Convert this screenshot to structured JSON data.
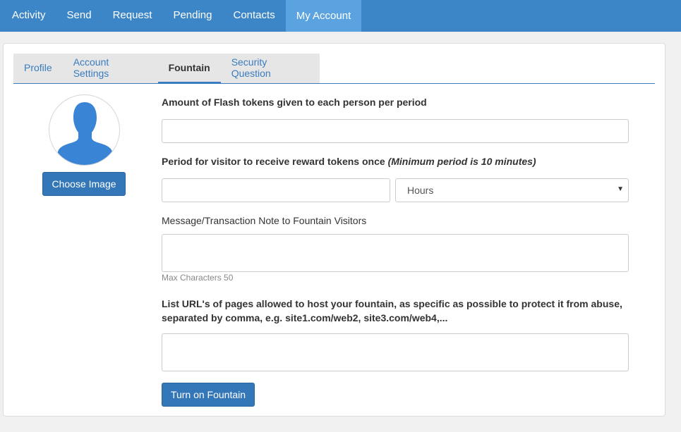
{
  "nav": {
    "items": [
      {
        "label": "Activity"
      },
      {
        "label": "Send"
      },
      {
        "label": "Request"
      },
      {
        "label": "Pending"
      },
      {
        "label": "Contacts"
      },
      {
        "label": "My Account"
      }
    ],
    "active": "My Account"
  },
  "tabs": {
    "items": [
      {
        "label": "Profile"
      },
      {
        "label": "Account Settings"
      },
      {
        "label": "Fountain"
      },
      {
        "label": "Security Question"
      }
    ],
    "active": "Fountain"
  },
  "profile": {
    "choose_image_label": "Choose Image"
  },
  "form": {
    "amount_label": "Amount of Flash tokens given to each person per period",
    "amount_value": "",
    "period_label": "Period for visitor to receive reward tokens once",
    "period_note": "(Minimum period is 10 minutes)",
    "period_value": "",
    "period_unit_selected": "Hours",
    "message_label": "Message/Transaction Note to Fountain Visitors",
    "message_value": "",
    "message_hint": "Max Characters 50",
    "urls_label_line1": "List URL's of pages allowed to host your fountain, as specific as possible to protect it from abuse,",
    "urls_label_line2": "separated by comma, e.g. site1.com/web2, site3.com/web4,...",
    "urls_value": "",
    "submit_label": "Turn on Fountain"
  },
  "colors": {
    "nav_bg": "#3c86c8",
    "nav_active_bg": "#5ba3e0",
    "primary_button": "#3477b9",
    "tab_link": "#3a7cbf",
    "avatar_fill": "#3a84d6"
  }
}
